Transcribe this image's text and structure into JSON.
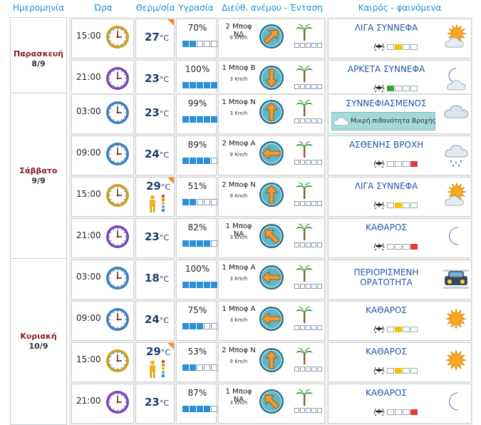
{
  "headers": {
    "date": "Ημερομηνία",
    "time": "Ώρα",
    "temp": "Θερμ/σία",
    "humidity": "Υγρασία",
    "wind": "Διεύθ. ανέμου - Ένταση",
    "weather": "Καιρός - φαινόμενα"
  },
  "temp_unit": "°C",
  "wind_unit": "Km/h",
  "days": [
    {
      "name": "Παρασκευή",
      "date": "8/9",
      "rows": [
        {
          "time": "15:00",
          "clock": "gold",
          "temp": "27",
          "feels": false,
          "hot_corner": true,
          "humidity": "70%",
          "hum_bars": 2,
          "wind": "2 Μποφ ΝΔ",
          "kmh": "9",
          "dir_deg": 225,
          "cond": "ΛΙΓΑ ΣΥΝΝΕΦΑ",
          "cond2": "",
          "icon": "sun-cloud-icon",
          "mosq": "yellow",
          "rain_note": ""
        },
        {
          "time": "21:00",
          "clock": "purple",
          "temp": "23",
          "feels": false,
          "hot_corner": false,
          "humidity": "100%",
          "hum_bars": 5,
          "wind": "1 Μποφ Β",
          "kmh": "3",
          "dir_deg": 0,
          "cond": "ΑΡΚΕΤΑ ΣΥΝΝΕΦΑ",
          "cond2": "",
          "icon": "moon-cloud-icon",
          "mosq": "green",
          "rain_note": ""
        }
      ]
    },
    {
      "name": "Σάββατο",
      "date": "9/9",
      "rows": [
        {
          "time": "03:00",
          "clock": "blue",
          "temp": "23",
          "feels": false,
          "hot_corner": false,
          "humidity": "99%",
          "hum_bars": 5,
          "wind": "1 Μποφ Ν",
          "kmh": "3",
          "dir_deg": 180,
          "cond": "ΣΥΝΝΕΦΙΑΣΜΕΝΟΣ",
          "cond2": "",
          "icon": "cloud-icon",
          "mosq": "none",
          "rain_note": "Μικρή πιθανότητα Βροχής"
        },
        {
          "time": "09:00",
          "clock": "blue",
          "temp": "24",
          "feels": false,
          "hot_corner": false,
          "humidity": "89%",
          "hum_bars": 4,
          "wind": "2 Μποφ Α",
          "kmh": "9",
          "dir_deg": 90,
          "cond": "ΑΣΘΕΝΗΣ ΒΡΟΧΗ",
          "cond2": "",
          "icon": "rain-cloud-icon",
          "mosq": "red",
          "rain_note": ""
        },
        {
          "time": "15:00",
          "clock": "gold",
          "temp": "29",
          "feels": true,
          "hot_corner": true,
          "humidity": "51%",
          "hum_bars": 2,
          "wind": "2 Μποφ Ν",
          "kmh": "9",
          "dir_deg": 180,
          "cond": "ΛΙΓΑ ΣΥΝΝΕΦΑ",
          "cond2": "",
          "icon": "sun-cloud-icon",
          "mosq": "yellow",
          "rain_note": ""
        },
        {
          "time": "21:00",
          "clock": "purple",
          "temp": "23",
          "feels": false,
          "hot_corner": false,
          "humidity": "82%",
          "hum_bars": 4,
          "wind": "1 Μποφ ΝΑ",
          "kmh": "3",
          "dir_deg": 135,
          "cond": "ΚΑΘΑΡΟΣ",
          "cond2": "",
          "icon": "moon-icon",
          "mosq": "red",
          "rain_note": ""
        }
      ]
    },
    {
      "name": "Κυριακή",
      "date": "10/9",
      "rows": [
        {
          "time": "03:00",
          "clock": "blue",
          "temp": "18",
          "feels": false,
          "hot_corner": false,
          "humidity": "100%",
          "hum_bars": 5,
          "wind": "1 Μποφ Α",
          "kmh": "3",
          "dir_deg": 90,
          "cond": "ΠΕΡΙΟΡΙΣΜΕΝΗ",
          "cond2": "ΟΡΑΤΟΤΗΤΑ",
          "icon": "fog-car-icon",
          "mosq": "none",
          "rain_note": ""
        },
        {
          "time": "09:00",
          "clock": "blue",
          "temp": "24",
          "feels": false,
          "hot_corner": false,
          "humidity": "75%",
          "hum_bars": 3,
          "wind": "1 Μποφ Α",
          "kmh": "3",
          "dir_deg": 90,
          "cond": "ΚΑΘΑΡΟΣ",
          "cond2": "",
          "icon": "sun-icon",
          "mosq": "yellow",
          "rain_note": ""
        },
        {
          "time": "15:00",
          "clock": "gold",
          "temp": "29",
          "feels": true,
          "hot_corner": true,
          "humidity": "53%",
          "hum_bars": 2,
          "wind": "2 Μποφ Ν",
          "kmh": "9",
          "dir_deg": 180,
          "cond": "ΚΑΘΑΡΟΣ",
          "cond2": "",
          "icon": "sun-icon",
          "mosq": "yellow",
          "rain_note": ""
        },
        {
          "time": "21:00",
          "clock": "purple",
          "temp": "23",
          "feels": false,
          "hot_corner": false,
          "humidity": "87%",
          "hum_bars": 4,
          "wind": "1 Μποφ ΝΑ",
          "kmh": "3",
          "dir_deg": 135,
          "cond": "ΚΑΘΑΡΟΣ",
          "cond2": "",
          "icon": "moon-icon",
          "mosq": "red",
          "rain_note": ""
        }
      ]
    }
  ],
  "colors": {
    "header_text": "#1f8fd1",
    "day_name": "#8b1a1a",
    "temp": "#1a3d6b",
    "condition": "#1f55a5",
    "group_bg": "#eeeeee"
  }
}
